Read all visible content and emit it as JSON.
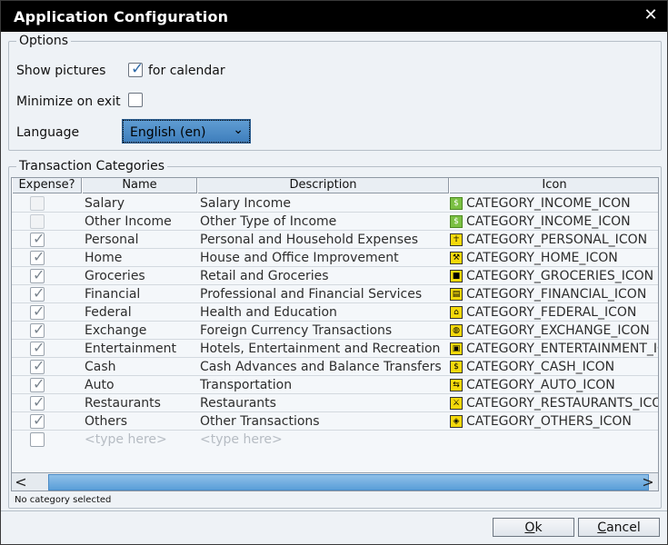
{
  "window": {
    "title": "Application Configuration",
    "close_glyph": "✕"
  },
  "options": {
    "legend": "Options",
    "show_pictures_label": "Show pictures",
    "show_pictures_checked": true,
    "for_calendar_label": "for calendar",
    "minimize_label": "Minimize on exit",
    "minimize_checked": false,
    "language_label": "Language",
    "language_value": "English (en)"
  },
  "categories": {
    "legend": "Transaction Categories",
    "columns": [
      "Expense?",
      "Name",
      "Description",
      "Icon"
    ],
    "rows": [
      {
        "expense": false,
        "name": "Salary",
        "description": "Salary Income",
        "icon": "CATEGORY_INCOME_ICON",
        "glyph": "$",
        "green": true
      },
      {
        "expense": false,
        "name": "Other Income",
        "description": "Other Type of Income",
        "icon": "CATEGORY_INCOME_ICON",
        "glyph": "$",
        "green": true
      },
      {
        "expense": true,
        "name": "Personal",
        "description": "Personal and Household Expenses",
        "icon": "CATEGORY_PERSONAL_ICON",
        "glyph": "☥"
      },
      {
        "expense": true,
        "name": "Home",
        "description": "House and Office Improvement",
        "icon": "CATEGORY_HOME_ICON",
        "glyph": "⚒"
      },
      {
        "expense": true,
        "name": "Groceries",
        "description": "Retail and Groceries",
        "icon": "CATEGORY_GROCERIES_ICON",
        "glyph": "■"
      },
      {
        "expense": true,
        "name": "Financial",
        "description": "Professional and Financial Services",
        "icon": "CATEGORY_FINANCIAL_ICON",
        "glyph": "▤"
      },
      {
        "expense": true,
        "name": "Federal",
        "description": "Health and Education",
        "icon": "CATEGORY_FEDERAL_ICON",
        "glyph": "⌂"
      },
      {
        "expense": true,
        "name": "Exchange",
        "description": "Foreign Currency Transactions",
        "icon": "CATEGORY_EXCHANGE_ICON",
        "glyph": "◍"
      },
      {
        "expense": true,
        "name": "Entertainment",
        "description": "Hotels, Entertainment and Recreation",
        "icon": "CATEGORY_ENTERTAINMENT_IC",
        "glyph": "▣"
      },
      {
        "expense": true,
        "name": "Cash",
        "description": "Cash Advances and Balance Transfers",
        "icon": "CATEGORY_CASH_ICON",
        "glyph": "$"
      },
      {
        "expense": true,
        "name": "Auto",
        "description": "Transportation",
        "icon": "CATEGORY_AUTO_ICON",
        "glyph": "⇆"
      },
      {
        "expense": true,
        "name": "Restaurants",
        "description": "Restaurants",
        "icon": "CATEGORY_RESTAURANTS_ICON",
        "glyph": "⚔"
      },
      {
        "expense": true,
        "name": "Others",
        "description": "Other Transactions",
        "icon": "CATEGORY_OTHERS_ICON",
        "glyph": "◈"
      }
    ],
    "new_row_placeholder": "<type here>",
    "scroll_left": "<",
    "scroll_right": ">"
  },
  "status_text": "No category selected",
  "buttons": {
    "ok": "Ok",
    "cancel": "Cancel"
  }
}
